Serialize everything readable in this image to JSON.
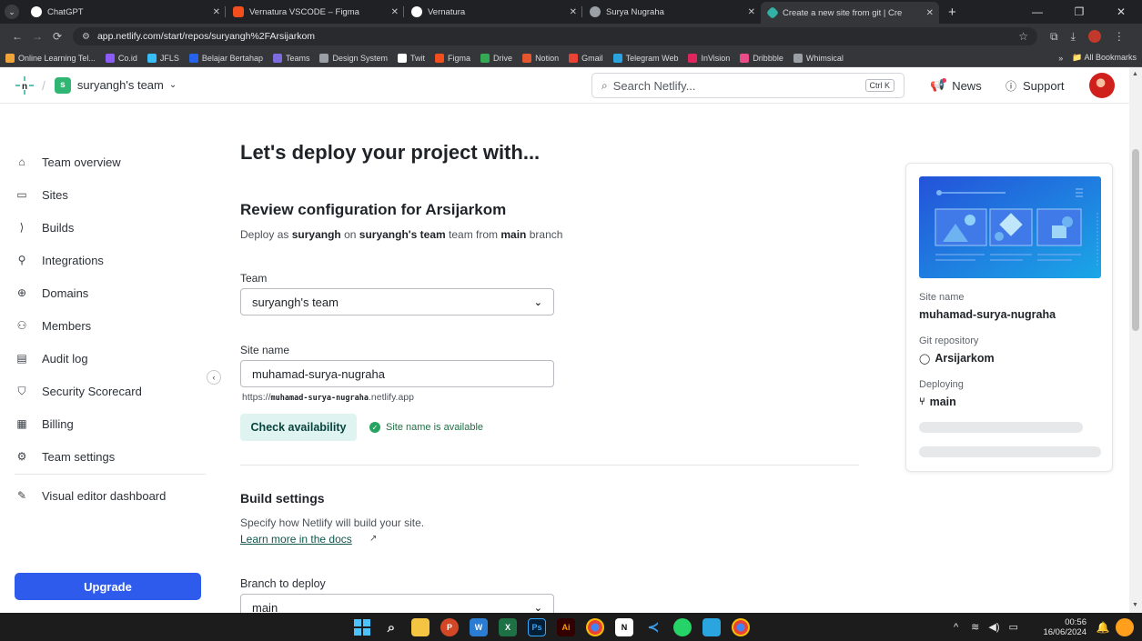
{
  "browser": {
    "tabs": [
      {
        "label": "ChatGPT",
        "color": "#ffffff"
      },
      {
        "label": "Vernatura VSCODE – Figma",
        "color": "#f24e1e"
      },
      {
        "label": "Vernatura",
        "color": "#ffffff"
      },
      {
        "label": "Surya Nugraha",
        "color": "#9aa0a6"
      },
      {
        "label": "Create a new site from git | Cre",
        "color": "#32b2a6"
      }
    ],
    "url": "app.netlify.com/start/repos/suryangh%2FArsijarkom",
    "bookmarks": [
      "Online Learning Tel...",
      "Co.id",
      "JFLS",
      "Belajar Bertahap",
      "Teams",
      "Design System",
      "Twit",
      "Figma",
      "Drive",
      "Notion",
      "Gmail",
      "Telegram Web",
      "InVision",
      "Dribbble",
      "Whimsical"
    ],
    "bookmark_colors": [
      "#f2a33a",
      "#8b5cf6",
      "#38bdf8",
      "#2563eb",
      "#7c6ce0",
      "#9aa0a6",
      "#ffffff",
      "#f24e1e",
      "#34a853",
      "#e4572e",
      "#ea4335",
      "#2aa3e0",
      "#e0245e",
      "#ea4c89",
      "#9aa0a6"
    ],
    "all_bookmarks": "All Bookmarks"
  },
  "header": {
    "team_initial": "s",
    "team_name": "suryangh's team",
    "search_placeholder": "Search Netlify...",
    "search_shortcut": "Ctrl K",
    "news": "News",
    "support": "Support"
  },
  "sidebar": {
    "items": [
      {
        "label": "Team overview",
        "icon": "home-icon"
      },
      {
        "label": "Sites",
        "icon": "sites-icon"
      },
      {
        "label": "Builds",
        "icon": "builds-icon"
      },
      {
        "label": "Integrations",
        "icon": "plug-icon"
      },
      {
        "label": "Domains",
        "icon": "globe-icon"
      },
      {
        "label": "Members",
        "icon": "members-icon"
      },
      {
        "label": "Audit log",
        "icon": "audit-icon"
      },
      {
        "label": "Security Scorecard",
        "icon": "shield-icon"
      },
      {
        "label": "Billing",
        "icon": "billing-icon"
      },
      {
        "label": "Team settings",
        "icon": "gear-icon"
      }
    ],
    "visual_editor": "Visual editor dashboard",
    "upgrade": "Upgrade"
  },
  "main": {
    "heading": "Let's deploy your project with...",
    "review_title": "Review configuration for Arsijarkom",
    "deploy_desc": {
      "prefix": "Deploy as",
      "user": "suryangh",
      "on": "on",
      "team": "suryangh's team",
      "team_word": "team from",
      "branch": "main",
      "suffix": "branch"
    },
    "team_label": "Team",
    "team_value": "suryangh's team",
    "site_name_label": "Site name",
    "site_name_value": "muhamad-surya-nugraha",
    "url_prefix": "https://",
    "url_name": "muhamad-surya-nugraha",
    "url_suffix": ".netlify.app",
    "check_button": "Check availability",
    "available_text": "Site name is available",
    "build_title": "Build settings",
    "build_desc": "Specify how Netlify will build your site.",
    "docs_link": "Learn more in the docs",
    "branch_label": "Branch to deploy",
    "branch_value": "main"
  },
  "card": {
    "site_name_label": "Site name",
    "site_name_value": "muhamad-surya-nugraha",
    "repo_label": "Git repository",
    "repo_value": "Arsijarkom",
    "deploying_label": "Deploying",
    "deploying_value": "main"
  },
  "taskbar": {
    "time": "00:56",
    "date": "16/06/2024"
  }
}
